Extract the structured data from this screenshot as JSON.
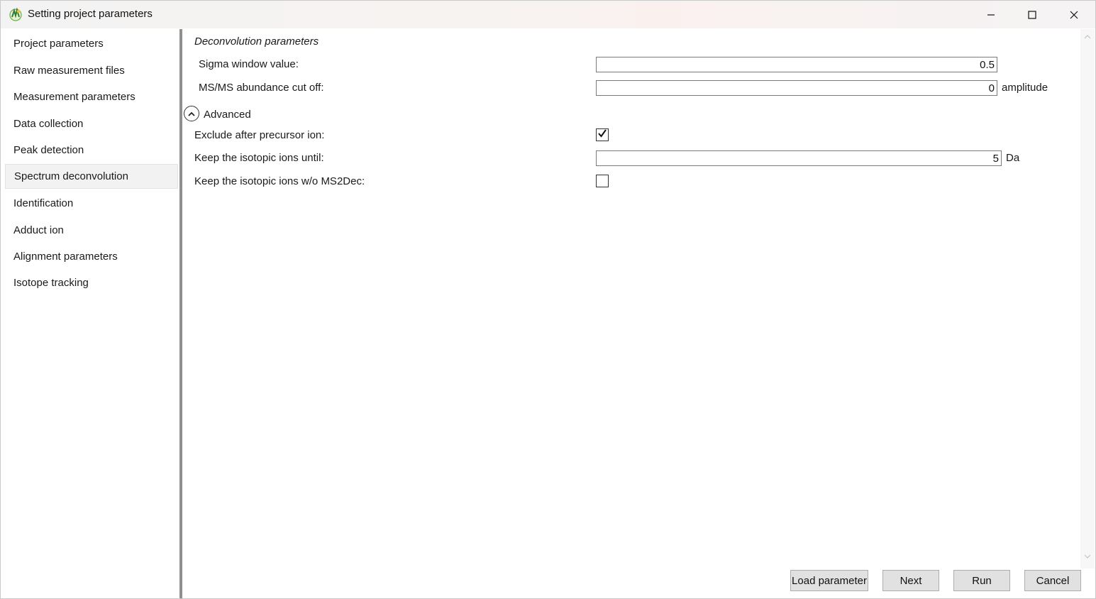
{
  "window": {
    "title": "Setting project parameters"
  },
  "sidebar": {
    "items": [
      {
        "label": "Project parameters",
        "selected": false
      },
      {
        "label": "Raw measurement files",
        "selected": false
      },
      {
        "label": "Measurement parameters",
        "selected": false
      },
      {
        "label": "Data collection",
        "selected": false
      },
      {
        "label": "Peak detection",
        "selected": false
      },
      {
        "label": "Spectrum deconvolution",
        "selected": true
      },
      {
        "label": "Identification",
        "selected": false
      },
      {
        "label": "Adduct ion",
        "selected": false
      },
      {
        "label": "Alignment parameters",
        "selected": false
      },
      {
        "label": "Isotope tracking",
        "selected": false
      }
    ]
  },
  "main": {
    "section_title": "Deconvolution parameters",
    "sigma": {
      "label": "Sigma window value:",
      "value": "0.5"
    },
    "msms_cutoff": {
      "label": "MS/MS abundance cut off:",
      "value": "0",
      "unit": "amplitude"
    },
    "advanced": {
      "label": "Advanced",
      "expanded": true,
      "exclude_after_precursor": {
        "label": "Exclude after precursor ion:",
        "checked": true
      },
      "keep_isotopic_until": {
        "label": "Keep the isotopic ions until:",
        "value": "5",
        "unit": "Da"
      },
      "keep_isotopic_wo_ms2dec": {
        "label": "Keep the isotopic ions w/o MS2Dec:",
        "checked": false
      }
    }
  },
  "footer": {
    "load_parameter": "Load parameter",
    "next": "Next",
    "run": "Run",
    "cancel": "Cancel"
  },
  "icons": {
    "app": "app-logo-icon",
    "minimize": "minimize-icon",
    "maximize": "maximize-icon",
    "close": "close-icon",
    "expander": "chevron-up-icon",
    "checkmark": "checkmark-icon"
  },
  "colors": {
    "splitter": "#8f8f8f",
    "selected_item_bg": "#f2f2f2",
    "button_bg": "#e1e1e1"
  }
}
